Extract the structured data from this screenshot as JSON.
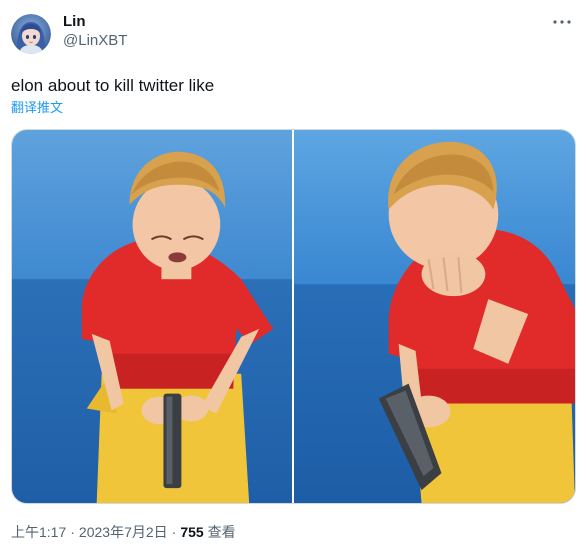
{
  "author": {
    "display_name": "Lin",
    "handle": "@LinXBT",
    "avatar_icon": "anime-avatar-icon"
  },
  "tweet": {
    "text": "elon about to kill twitter like",
    "translate_label": "翻译推文"
  },
  "media": {
    "photos": [
      {
        "description_name": "photo-left"
      },
      {
        "description_name": "photo-right"
      }
    ]
  },
  "meta": {
    "time": "上午1:17",
    "separator": "·",
    "date": "2023年7月2日",
    "views_count": "755",
    "views_label": "查看"
  },
  "colors": {
    "accent": "#1d9bf0",
    "secondary_text": "#536471",
    "primary_text": "#0f1419",
    "border": "#cfd9de"
  },
  "icons": {
    "more": "more-dots-icon"
  }
}
